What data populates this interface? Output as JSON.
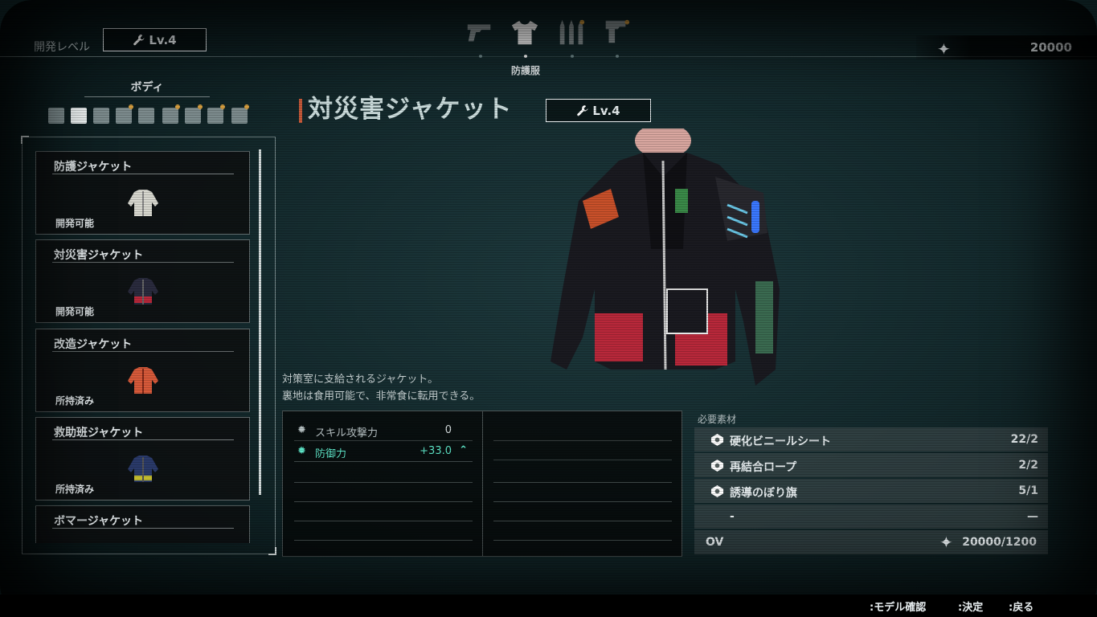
{
  "header": {
    "dev_level_label": "開発レベル",
    "dev_level_value": "Lv.4",
    "currency_icon": "sparkle-icon",
    "currency_value": "20000"
  },
  "category_tabs": {
    "items": [
      {
        "icon": "pistol-icon",
        "active": false
      },
      {
        "icon": "shirt-icon",
        "active": true
      },
      {
        "icon": "ammo-icon",
        "active": false
      },
      {
        "icon": "tool-icon",
        "active": false
      }
    ],
    "active_label": "防護服"
  },
  "sidebar": {
    "section_label": "ボディ",
    "items": [
      {
        "name": "防護ジャケット",
        "status": "開発可能",
        "color": "#d8d8d0"
      },
      {
        "name": "対災害ジャケット",
        "status": "開発可能",
        "color": "#b8283a"
      },
      {
        "name": "改造ジャケット",
        "status": "所持済み",
        "color": "#d85a3a"
      },
      {
        "name": "救助班ジャケット",
        "status": "所持済み",
        "color": "#2a3a6a"
      },
      {
        "name": "ボマージャケット",
        "status": "",
        "color": "#555"
      }
    ]
  },
  "item": {
    "title": "対災害ジャケット",
    "level": "Lv.4",
    "description_line1": "対策室に支給されるジャケット。",
    "description_line2": "裏地は食用可能で、非常食に転用できる。"
  },
  "stats": [
    {
      "label": "スキル攻撃力",
      "value": "0",
      "highlight": false
    },
    {
      "label": "防御力",
      "value": "+33.0",
      "highlight": true
    }
  ],
  "materials": {
    "header": "必要素材",
    "items": [
      {
        "name": "硬化ビニールシート",
        "count": "22/2"
      },
      {
        "name": "再結合ロープ",
        "count": "2/2"
      },
      {
        "name": "誘導のぼり旗",
        "count": "5/1"
      },
      {
        "name": "-",
        "count": "—"
      }
    ],
    "ov_label": "OV",
    "ov_value": "20000/1200"
  },
  "footer": {
    "hints": [
      ":モデル確認",
      ":決定",
      ":戻る"
    ]
  },
  "colors": {
    "accent_teal": "#5ee6c8",
    "title_marker": "#c75a3a",
    "status_dot": "#d8a040"
  }
}
